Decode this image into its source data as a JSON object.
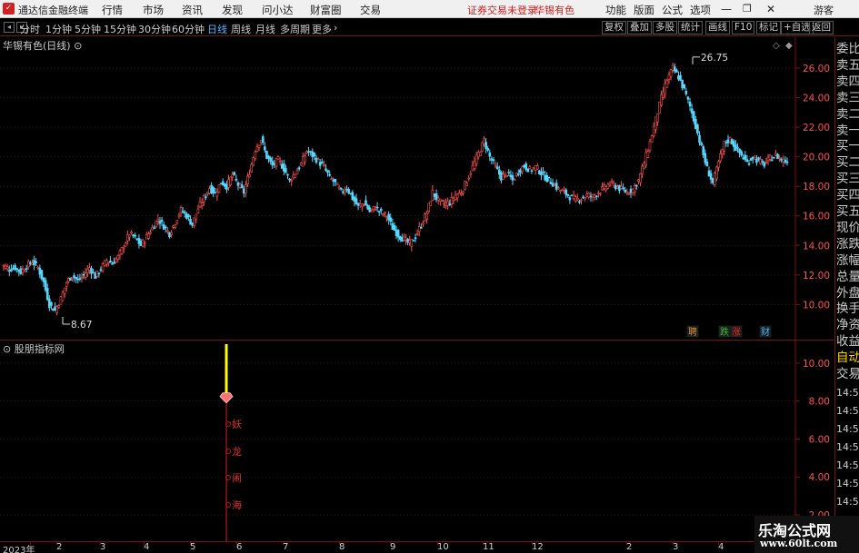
{
  "window": {
    "app_name": "通达信金融终端",
    "menu": [
      "行情",
      "市场",
      "资讯",
      "发现",
      "问小达",
      "财富圈",
      "交易"
    ],
    "login_status": "证券交易未登录",
    "stock_name": "华锡有色",
    "right_menu": [
      "功能",
      "版面",
      "公式",
      "选项"
    ],
    "guest": "游客"
  },
  "toolbar": {
    "periods": [
      "分时",
      "1分钟",
      "5分钟",
      "15分钟",
      "30分钟",
      "60分钟",
      "日线",
      "周线",
      "月线",
      "多周期",
      "更多"
    ],
    "active_period": "日线",
    "buttons": [
      "复权",
      "叠加",
      "多股",
      "统计",
      "画线",
      "F10",
      "标记",
      "+自选",
      "返回"
    ]
  },
  "main_chart": {
    "label": "华锡有色(日线)",
    "high_label": "26.75",
    "low_label": "8.67",
    "badges": [
      {
        "text": "聘",
        "color": "#d09040"
      },
      {
        "text": "跌",
        "color": "#30c030"
      },
      {
        "text": "涨",
        "color": "#e03030"
      },
      {
        "text": "财",
        "color": "#4fb4ff"
      }
    ]
  },
  "sub_chart": {
    "label": "股朋指标网",
    "signal_chars": [
      "妖",
      "龙",
      "闹",
      "海"
    ]
  },
  "right_panel": {
    "items": [
      "委比",
      "卖五",
      "卖四",
      "卖三",
      "卖二",
      "卖一",
      "买一",
      "买二",
      "买三",
      "买四",
      "买五",
      "现价",
      "涨跌",
      "涨幅",
      "总量",
      "外盘",
      "换手",
      "净资",
      "收益",
      "自动",
      "交易",
      "14:56",
      "14:56",
      "14:56",
      "14:56",
      "14:56",
      "14:56",
      "14:56",
      "14:56"
    ]
  },
  "x_axis": {
    "labels": [
      "2023年",
      "2",
      "3",
      "4",
      "5",
      "6",
      "7",
      "8",
      "9",
      "10",
      "11",
      "12",
      "2",
      "3",
      "4"
    ]
  },
  "watermark": {
    "line1": "乐淘公式网",
    "line2": "www.60lt.com"
  },
  "colors": {
    "up": "#ff5050",
    "down": "#54d8ff",
    "grid_red": "#7a1010",
    "signal_yellow": "#ffff00"
  },
  "chart_data": [
    {
      "type": "candlestick",
      "title": "华锡有色(日线)",
      "y_ticks": [
        10.0,
        12.0,
        14.0,
        16.0,
        18.0,
        20.0,
        22.0,
        24.0,
        26.0
      ],
      "ylim": [
        8.3,
        27.6
      ],
      "x_ticks": [
        "2023年",
        "2",
        "3",
        "4",
        "5",
        "6",
        "7",
        "8",
        "9",
        "10",
        "11",
        "12",
        "2",
        "3",
        "4"
      ],
      "annotations": [
        {
          "label": "26.75",
          "kind": "high"
        },
        {
          "label": "8.67",
          "kind": "low"
        }
      ],
      "close_path_estimate": [
        12.6,
        12.4,
        12.5,
        12.2,
        12.6,
        12.9,
        12.5,
        11.5,
        10.0,
        9.6,
        10.4,
        11.5,
        12.0,
        11.6,
        12.0,
        12.5,
        11.9,
        12.4,
        13.0,
        12.8,
        13.2,
        14.0,
        14.8,
        14.5,
        14.0,
        14.6,
        15.2,
        15.8,
        15.3,
        14.8,
        15.6,
        16.4,
        16.0,
        15.4,
        16.5,
        17.2,
        17.9,
        17.5,
        18.3,
        18.0,
        18.8,
        18.1,
        17.6,
        19.0,
        20.5,
        21.2,
        20.0,
        19.4,
        19.8,
        19.2,
        18.4,
        18.9,
        19.5,
        20.4,
        20.1,
        19.7,
        19.3,
        18.6,
        18.2,
        17.6,
        17.9,
        17.2,
        16.6,
        16.9,
        16.3,
        16.6,
        16.2,
        16.0,
        15.2,
        14.7,
        14.4,
        14.1,
        14.6,
        15.4,
        16.2,
        17.6,
        17.0,
        16.8,
        16.9,
        17.4,
        17.6,
        18.4,
        19.3,
        20.2,
        21.1,
        20.0,
        19.3,
        18.6,
        18.9,
        18.4,
        19.0,
        19.4,
        19.1,
        19.3,
        18.9,
        18.5,
        18.2,
        17.8,
        17.6,
        17.3,
        17.1,
        17.2,
        17.4,
        17.3,
        17.6,
        17.9,
        18.2,
        18.0,
        17.8,
        17.6,
        17.8,
        18.4,
        19.6,
        21.0,
        22.5,
        24.0,
        25.2,
        26.0,
        25.4,
        24.5,
        23.4,
        22.1,
        20.6,
        19.2,
        18.2,
        19.6,
        20.9,
        21.2,
        20.6,
        20.1,
        19.6,
        20.0,
        19.7,
        19.5,
        19.9,
        20.1,
        19.8,
        19.7
      ]
    },
    {
      "type": "bar",
      "title": "股朋指标网",
      "y_ticks": [
        2.0,
        4.0,
        6.0,
        8.0,
        10.0
      ],
      "ylim": [
        0.9,
        11.0
      ],
      "series": [
        {
          "values": [
            8.0,
            11.0
          ],
          "color": "#ffff00"
        },
        {
          "values": [
            0,
            8.0
          ],
          "color": "#d02020"
        }
      ]
    }
  ]
}
